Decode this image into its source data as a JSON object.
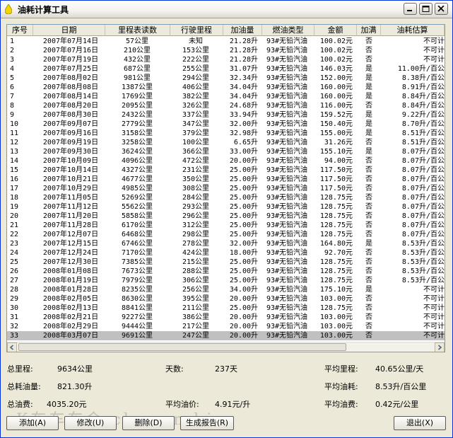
{
  "window": {
    "title": "油耗计算工具"
  },
  "columns": [
    "序号",
    "日期",
    "里程表读数",
    "行驶里程",
    "加油量",
    "燃油类型",
    "金额",
    "加满",
    "油耗估算"
  ],
  "rows": [
    [
      "1",
      "2007年07月14日",
      "57公里",
      "未知",
      "21.28升",
      "93#无铅汽油",
      "100.02元",
      "否",
      "不可计算"
    ],
    [
      "2",
      "2007年07月16日",
      "210公里",
      "153公里",
      "21.28升",
      "93#无铅汽油",
      "100.02元",
      "否",
      "不可计算"
    ],
    [
      "3",
      "2007年07月19日",
      "432公里",
      "222公里",
      "21.28升",
      "93#无铅汽油",
      "100.02元",
      "否",
      "不可计算"
    ],
    [
      "4",
      "2007年07月25日",
      "687公里",
      "255公里",
      "31.07升",
      "93#无铅汽油",
      "146.03元",
      "是",
      "11.00升/百公里"
    ],
    [
      "5",
      "2007年08月02日",
      "981公里",
      "294公里",
      "32.34升",
      "93#无铅汽油",
      "152.00元",
      "是",
      "8.38升/百公里"
    ],
    [
      "6",
      "2007年08月08日",
      "1387公里",
      "406公里",
      "34.04升",
      "93#无铅汽油",
      "160.00元",
      "是",
      "8.91升/百公里"
    ],
    [
      "7",
      "2007年08月14日",
      "1769公里",
      "382公里",
      "34.04升",
      "93#无铅汽油",
      "160.00元",
      "是",
      "8.84升/百公里"
    ],
    [
      "8",
      "2007年08月20日",
      "2095公里",
      "326公里",
      "24.68升",
      "93#无铅汽油",
      "116.00元",
      "否",
      "8.84升/百公里"
    ],
    [
      "9",
      "2007年08月30日",
      "2432公里",
      "337公里",
      "33.94升",
      "93#无铅汽油",
      "159.52元",
      "是",
      "9.22升/百公里"
    ],
    [
      "10",
      "2007年09月07日",
      "2779公里",
      "347公里",
      "32.00升",
      "93#无铅汽油",
      "150.40元",
      "是",
      "8.70升/百公里"
    ],
    [
      "11",
      "2007年09月16日",
      "3158公里",
      "379公里",
      "32.98升",
      "93#无铅汽油",
      "155.00元",
      "是",
      "8.51升/百公里"
    ],
    [
      "12",
      "2007年09月19日",
      "3258公里",
      "100公里",
      "6.65升",
      "93#无铅汽油",
      "31.26元",
      "否",
      "8.51升/百公里"
    ],
    [
      "13",
      "2007年09月30日",
      "3624公里",
      "366公里",
      "33.00升",
      "93#无铅汽油",
      "155.10元",
      "是",
      "8.07升/百公里"
    ],
    [
      "14",
      "2007年10月09日",
      "4096公里",
      "472公里",
      "20.00升",
      "93#无铅汽油",
      "94.00元",
      "否",
      "8.07升/百公里"
    ],
    [
      "15",
      "2007年10月14日",
      "4327公里",
      "231公里",
      "25.00升",
      "93#无铅汽油",
      "117.50元",
      "否",
      "8.07升/百公里"
    ],
    [
      "16",
      "2007年10月21日",
      "4677公里",
      "350公里",
      "25.00升",
      "93#无铅汽油",
      "117.50元",
      "否",
      "8.07升/百公里"
    ],
    [
      "17",
      "2007年10月29日",
      "4985公里",
      "308公里",
      "25.00升",
      "93#无铅汽油",
      "117.50元",
      "否",
      "8.07升/百公里"
    ],
    [
      "18",
      "2007年11月05日",
      "5269公里",
      "284公里",
      "25.00升",
      "93#无铅汽油",
      "128.75元",
      "否",
      "8.07升/百公里"
    ],
    [
      "19",
      "2007年11月12日",
      "5562公里",
      "293公里",
      "25.00升",
      "93#无铅汽油",
      "128.75元",
      "否",
      "8.07升/百公里"
    ],
    [
      "20",
      "2007年11月20日",
      "5858公里",
      "296公里",
      "25.00升",
      "93#无铅汽油",
      "128.75元",
      "否",
      "8.07升/百公里"
    ],
    [
      "21",
      "2007年11月28日",
      "6170公里",
      "312公里",
      "25.00升",
      "93#无铅汽油",
      "128.75元",
      "否",
      "8.07升/百公里"
    ],
    [
      "22",
      "2007年12月07日",
      "6468公里",
      "298公里",
      "25.00升",
      "93#无铅汽油",
      "128.75元",
      "否",
      "8.07升/百公里"
    ],
    [
      "23",
      "2007年12月15日",
      "6746公里",
      "278公里",
      "32.00升",
      "93#无铅汽油",
      "164.80元",
      "是",
      "8.53升/百公里"
    ],
    [
      "24",
      "2007年12月24日",
      "7170公里",
      "424公里",
      "18.00升",
      "93#无铅汽油",
      "92.70元",
      "否",
      "8.53升/百公里"
    ],
    [
      "25",
      "2007年12月30日",
      "7385公里",
      "215公里",
      "25.00升",
      "93#无铅汽油",
      "128.75元",
      "否",
      "8.53升/百公里"
    ],
    [
      "26",
      "2008年01月08日",
      "7673公里",
      "288公里",
      "25.00升",
      "93#无铅汽油",
      "128.75元",
      "否",
      "8.53升/百公里"
    ],
    [
      "27",
      "2008年01月19日",
      "7979公里",
      "306公里",
      "25.00升",
      "93#无铅汽油",
      "128.75元",
      "否",
      "8.53升/百公里"
    ],
    [
      "28",
      "2008年01月28日",
      "8235公里",
      "256公里",
      "34.00升",
      "93#无铅汽油",
      "175.10元",
      "是",
      "不可计算"
    ],
    [
      "29",
      "2008年02月05日",
      "8630公里",
      "395公里",
      "20.00升",
      "93#无铅汽油",
      "103.00元",
      "否",
      "不可计算"
    ],
    [
      "30",
      "2008年02月13日",
      "8841公里",
      "211公里",
      "25.00升",
      "93#无铅汽油",
      "128.75元",
      "否",
      "不可计算"
    ],
    [
      "31",
      "2008年02月21日",
      "9227公里",
      "386公里",
      "20.00升",
      "93#无铅汽油",
      "103.00元",
      "否",
      "不可计算"
    ],
    [
      "32",
      "2008年02月29日",
      "9444公里",
      "217公里",
      "20.00升",
      "93#无铅汽油",
      "103.00元",
      "否",
      "不可计算"
    ],
    [
      "33",
      "2008年03月07日",
      "9691公里",
      "247公里",
      "20.00升",
      "93#无铅汽油",
      "103.00元",
      "否",
      "不可计算"
    ]
  ],
  "selected_row": 33,
  "summary": {
    "total_distance_label": "总里程:",
    "total_distance": "9634公里",
    "days_label": "天数:",
    "days": "237天",
    "avg_distance_label": "平均里程:",
    "avg_distance": "40.65公里/天",
    "total_fuel_label": "总耗油量:",
    "total_fuel": "821.30升",
    "avg_consumption_label": "平均油耗:",
    "avg_consumption": "8.53升/百公里",
    "total_cost_label": "总油费:",
    "total_cost": "4035.20元",
    "avg_price_label": "平均油价:",
    "avg_price": "4.91元/升",
    "avg_cost_label": "平均油费:",
    "avg_cost": "0.42元/公里"
  },
  "buttons": {
    "add": "添加(A)",
    "edit": "修改(U)",
    "delete": "删除(D)",
    "report": "生成报告(R)",
    "exit": "退出(X)"
  },
  "watermark": "K车车车会 chenen.biz",
  "colors": {
    "title_border": "#0831d9",
    "selected_row": "#c0c0c0",
    "window_bg": "#ece9d8"
  }
}
